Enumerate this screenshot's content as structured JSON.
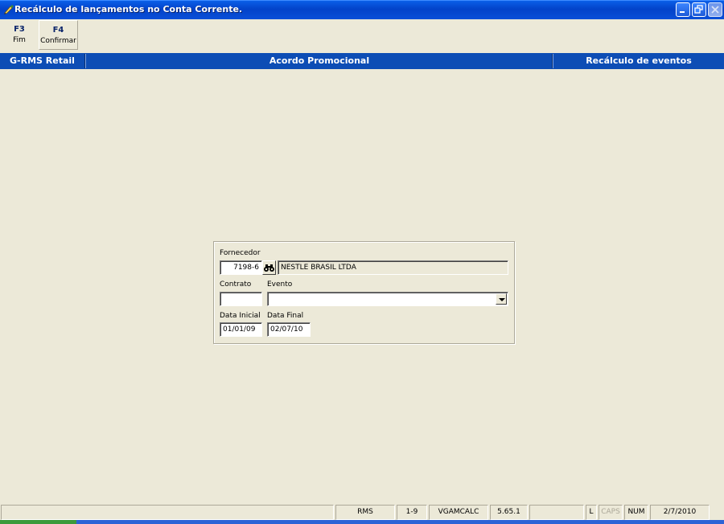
{
  "window": {
    "title": "Recálculo de lançamentos no Conta Corrente."
  },
  "toolbar": {
    "buttons": [
      {
        "key": "F3",
        "label": "Fim"
      },
      {
        "key": "F4",
        "label": "Confirmar"
      }
    ]
  },
  "header": {
    "left": "G-RMS Retail",
    "center": "Acordo Promocional",
    "right": "Recálculo de eventos"
  },
  "form": {
    "fornecedor": {
      "label": "Fornecedor",
      "code": "7198-6",
      "name": "NESTLE BRASIL LTDA"
    },
    "contrato": {
      "label": "Contrato",
      "value": ""
    },
    "evento": {
      "label": "Evento",
      "value": ""
    },
    "data_inicial": {
      "label": "Data Inicial",
      "value": "01/01/09"
    },
    "data_final": {
      "label": "Data Final",
      "value": "02/07/10"
    }
  },
  "statusbar": {
    "cells": [
      "",
      "RMS",
      "1-9",
      "VGAMCALC",
      "5.65.1",
      "",
      "L",
      "CAPS",
      "NUM",
      "2/7/2010"
    ]
  },
  "colors": {
    "titlebar": "#0343c9",
    "header_band": "#0d4db5",
    "background": "#ece9d8"
  }
}
